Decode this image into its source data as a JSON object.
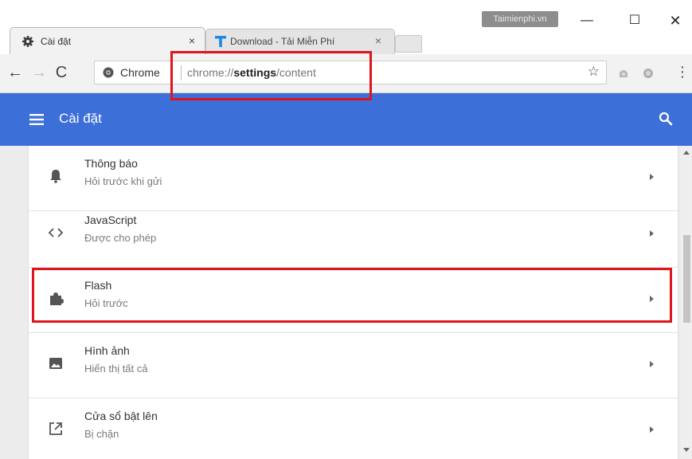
{
  "window": {
    "watermark": "Taimienphi.vn",
    "minimize_glyph": "—",
    "maximize_glyph": "☐",
    "close_glyph": "✕"
  },
  "tabs": [
    {
      "title": "Cài đặt",
      "icon": "gear-icon",
      "close": "×",
      "active": true
    },
    {
      "title": "Download - Tải Miễn Phí",
      "icon": "t-logo-icon",
      "close": "×",
      "active": false
    }
  ],
  "toolbar": {
    "back_glyph": "←",
    "forward_glyph": "→",
    "reload_glyph": "C",
    "omnibox": {
      "chip_label": "Chrome",
      "url_prefix": "chrome://",
      "url_bold": "settings",
      "url_suffix": "/content",
      "star_glyph": "☆"
    },
    "menu_glyph": "⋮"
  },
  "header": {
    "title": "Cài đặt",
    "menu_icon": "hamburger-icon",
    "search_icon": "search-icon"
  },
  "settings_rows": [
    {
      "title": "Thông báo",
      "subtitle": "Hỏi trước khi gửi",
      "icon": "bell-icon"
    },
    {
      "title": "JavaScript",
      "subtitle": "Được cho phép",
      "icon": "code-icon"
    },
    {
      "title": "Flash",
      "subtitle": "Hỏi trước",
      "icon": "puzzle-icon"
    },
    {
      "title": "Hình ảnh",
      "subtitle": "Hiển thị tất cả",
      "icon": "image-icon"
    },
    {
      "title": "Cửa sổ bật lên",
      "subtitle": "Bị chặn",
      "icon": "popup-icon"
    }
  ],
  "colors": {
    "header_bg": "#3d6fd9",
    "highlight": "#e0141d",
    "tab_bg": "#f2f2f2"
  }
}
